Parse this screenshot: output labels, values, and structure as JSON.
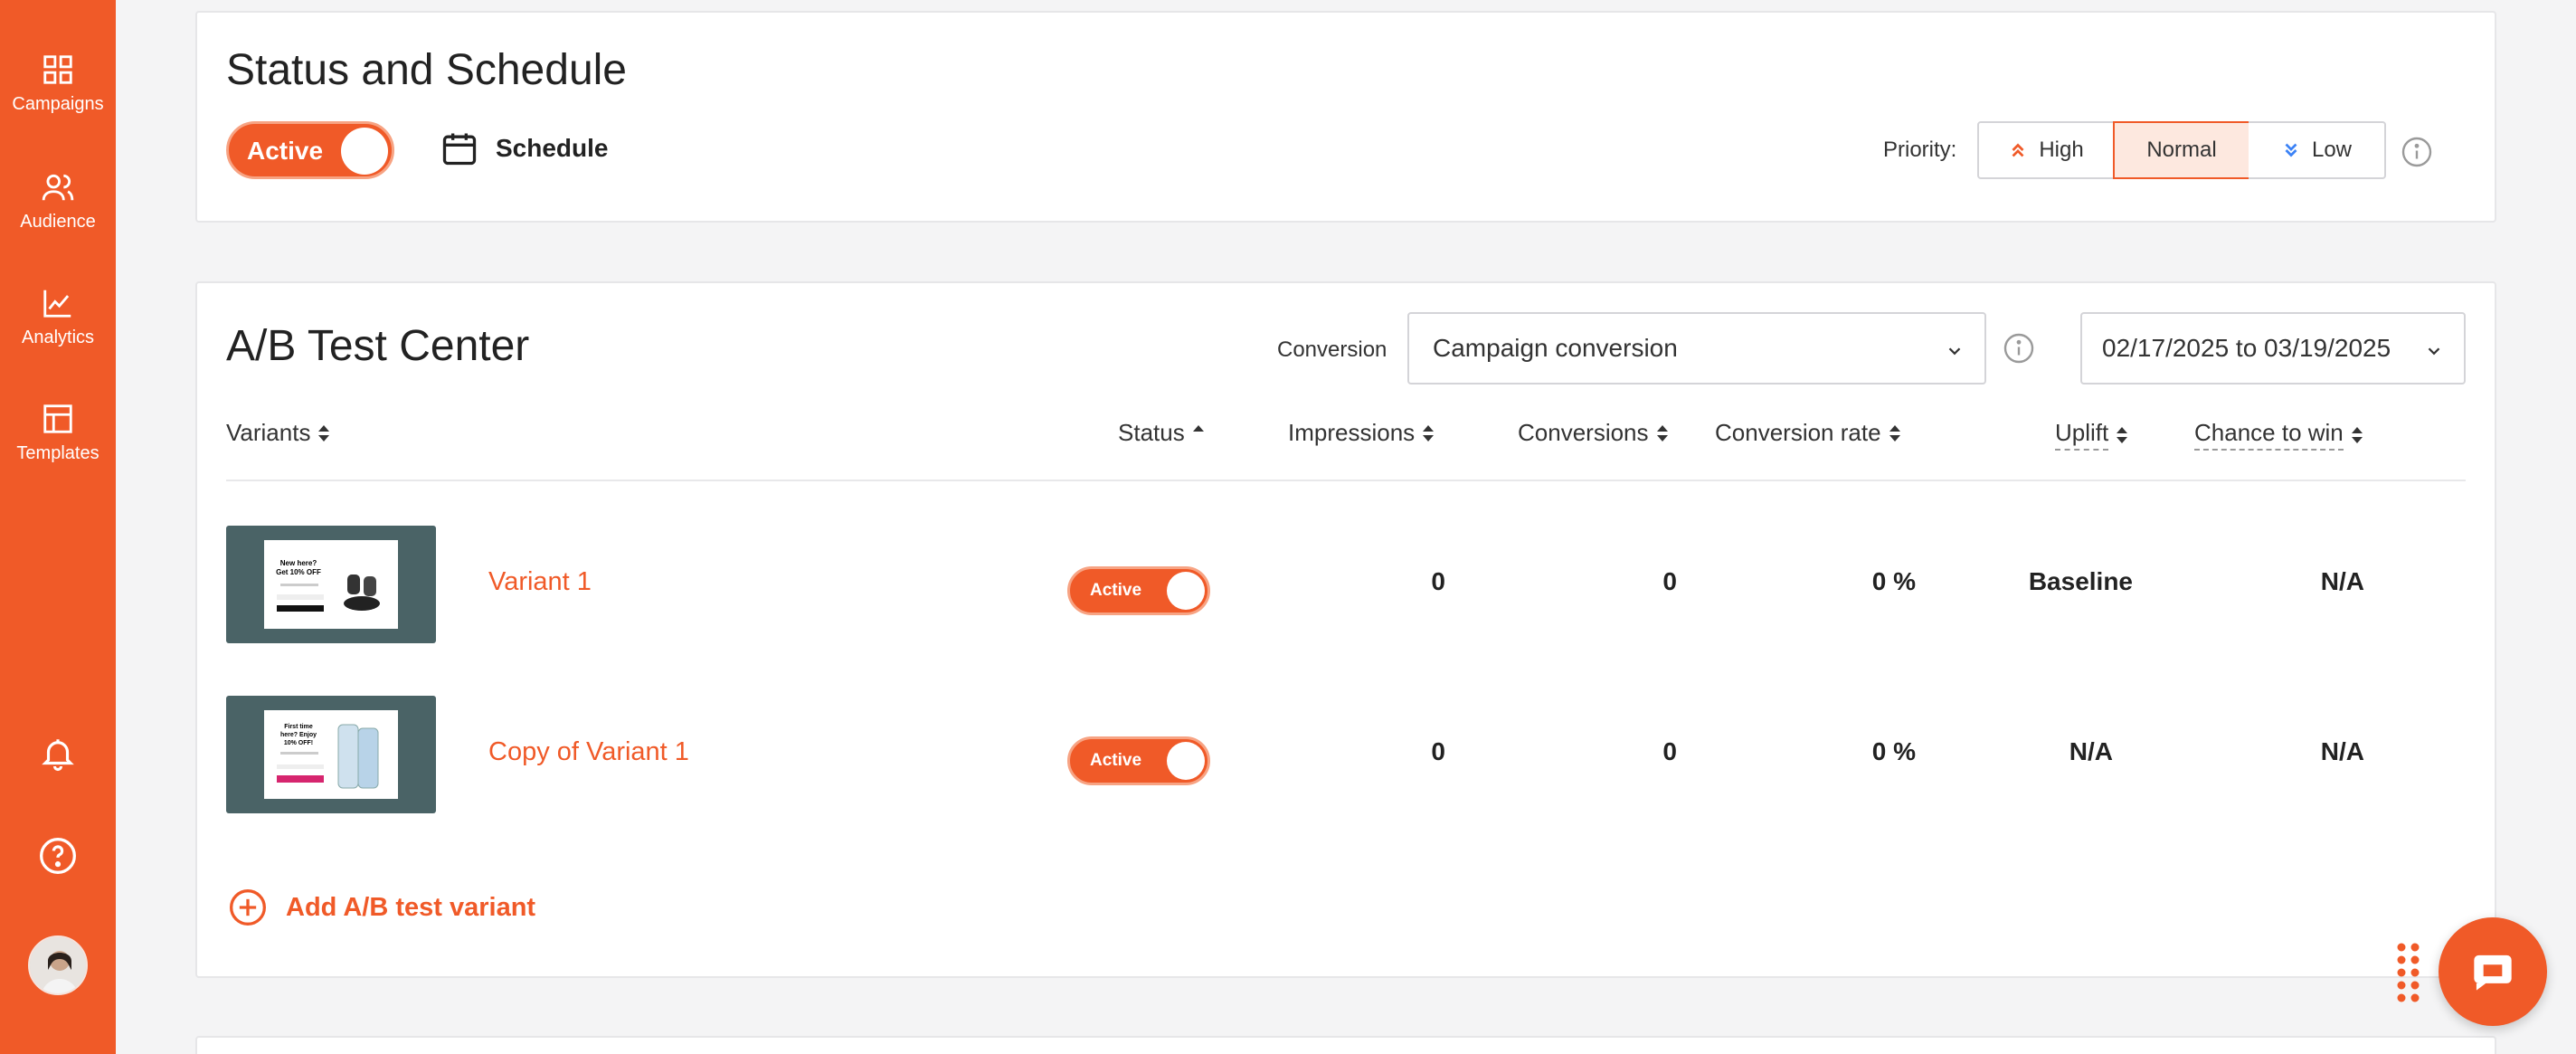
{
  "sidebar": {
    "items": [
      {
        "label": "Campaigns",
        "icon": "grid-icon"
      },
      {
        "label": "Audience",
        "icon": "users-icon"
      },
      {
        "label": "Analytics",
        "icon": "chart-line-icon"
      },
      {
        "label": "Templates",
        "icon": "layout-icon"
      }
    ],
    "bottom_icons": [
      "bell-icon",
      "help-icon",
      "avatar"
    ]
  },
  "status": {
    "title": "Status and Schedule",
    "toggle_label": "Active",
    "schedule_label": "Schedule",
    "priority_label": "Priority:",
    "priority_options": [
      "High",
      "Normal",
      "Low"
    ],
    "priority_selected": "Normal"
  },
  "ab": {
    "title": "A/B Test Center",
    "conversion_label": "Conversion",
    "conversion_value": "Campaign conversion",
    "date_range": "02/17/2025 to 03/19/2025",
    "columns": {
      "variants": "Variants",
      "status": "Status",
      "impressions": "Impressions",
      "conversions": "Conversions",
      "conversion_rate": "Conversion rate",
      "uplift": "Uplift",
      "chance": "Chance to win"
    },
    "rows": [
      {
        "name": "Variant 1",
        "status": "Active",
        "impressions": "0",
        "conversions": "0",
        "rate": "0 %",
        "uplift": "Baseline",
        "chance": "N/A",
        "thumb_text": "New here? Get 10% OFF"
      },
      {
        "name": "Copy of Variant 1",
        "status": "Active",
        "impressions": "0",
        "conversions": "0",
        "rate": "0 %",
        "uplift": "N/A",
        "chance": "N/A",
        "thumb_text": "First time here? Enjoy 10% OFF!"
      }
    ],
    "add_label": "Add A/B test variant"
  },
  "colors": {
    "accent": "#f05a28",
    "thumb_bg": "#4a6366",
    "low_icon": "#3b82f6"
  }
}
